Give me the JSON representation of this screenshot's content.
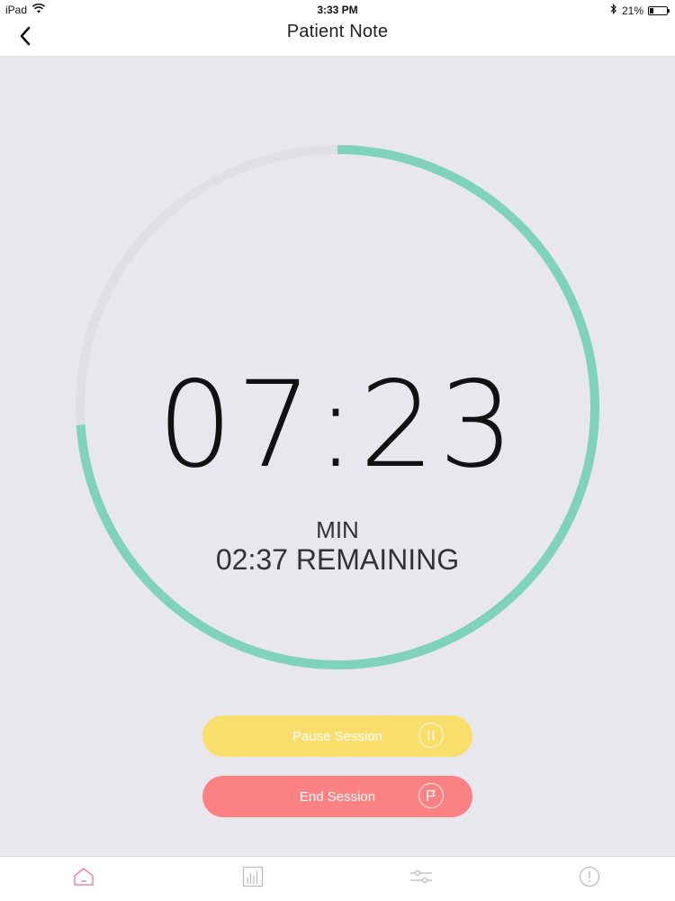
{
  "status_bar": {
    "device": "iPad",
    "time": "3:33 PM",
    "battery_percent": "21%",
    "battery_level": 0.21
  },
  "nav": {
    "title": "Patient Note",
    "back_icon": "chevron-left-icon"
  },
  "timer": {
    "elapsed": "07:23",
    "unit": "MIN",
    "remaining_text": "02:37 REMAINING",
    "progress_fraction": 0.739,
    "progress_color": "#7fd3bd",
    "track_color": "#dfdfe6"
  },
  "actions": {
    "pause_label": "Pause Session",
    "pause_color": "#f9de6b",
    "pause_icon": "pause-icon",
    "end_label": "End Session",
    "end_color": "#fc8183",
    "end_icon": "flag-icon"
  },
  "tab_bar": {
    "items": [
      {
        "icon": "home-icon",
        "active": true
      },
      {
        "icon": "chart-icon",
        "active": false
      },
      {
        "icon": "sliders-icon",
        "active": false
      },
      {
        "icon": "info-icon",
        "active": false
      }
    ],
    "active_color": "#f06ea0",
    "inactive_color": "#b8b8c0"
  }
}
